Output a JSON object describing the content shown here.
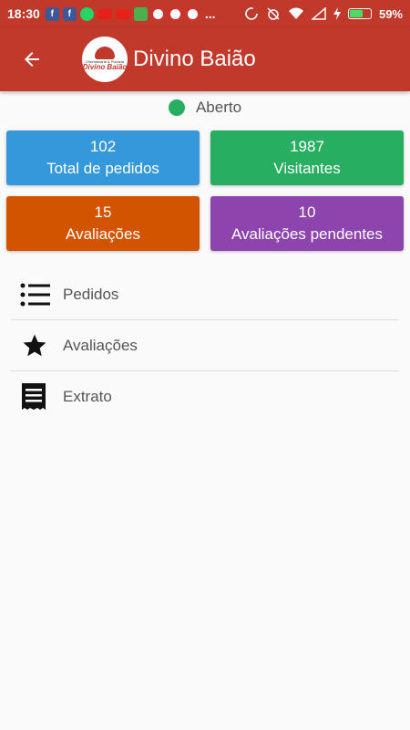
{
  "status_bar": {
    "time": "18:30",
    "battery": "59%",
    "battery_level": 0.59,
    "overflow": "..."
  },
  "app_bar": {
    "title": "Divino Baião",
    "logo_small_text": "Churrascaria & Pizzaria",
    "logo_name": "Divino Baião"
  },
  "store_status": {
    "label": "Aberto",
    "color": "#27ae60"
  },
  "stats": {
    "orders": {
      "value": "102",
      "label": "Total de pedidos",
      "color": "#3498db"
    },
    "visitors": {
      "value": "1987",
      "label": "Visitantes",
      "color": "#27ae60"
    },
    "reviews": {
      "value": "15",
      "label": "Avaliações",
      "color": "#d35400"
    },
    "pending_reviews": {
      "value": "10",
      "label": "Avaliações pendentes",
      "color": "#8e44ad"
    }
  },
  "menu": {
    "items": [
      {
        "label": "Pedidos",
        "icon": "list-icon"
      },
      {
        "label": "Avaliações",
        "icon": "star-icon"
      },
      {
        "label": "Extrato",
        "icon": "receipt-icon"
      }
    ]
  }
}
